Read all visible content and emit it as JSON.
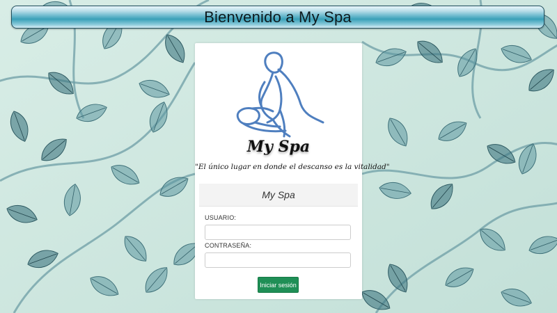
{
  "header": {
    "title": "Bienvenido a My Spa"
  },
  "logo": {
    "icon": "massage-figure-icon",
    "text": "My Spa"
  },
  "slogan": "\"El único lugar en donde el descanso es la vitalidad\"",
  "login_panel": {
    "title": "My Spa",
    "username_label": "USUARIO:",
    "username_value": "",
    "password_label": "CONTRASEÑA:",
    "password_value": "",
    "submit_label": "Iniciar sesión"
  },
  "colors": {
    "header_accent": "#3aa0b8",
    "button_green": "#1f8f56",
    "logo_stroke": "#4f7fbf",
    "background_leaf": "#4f8b95"
  }
}
